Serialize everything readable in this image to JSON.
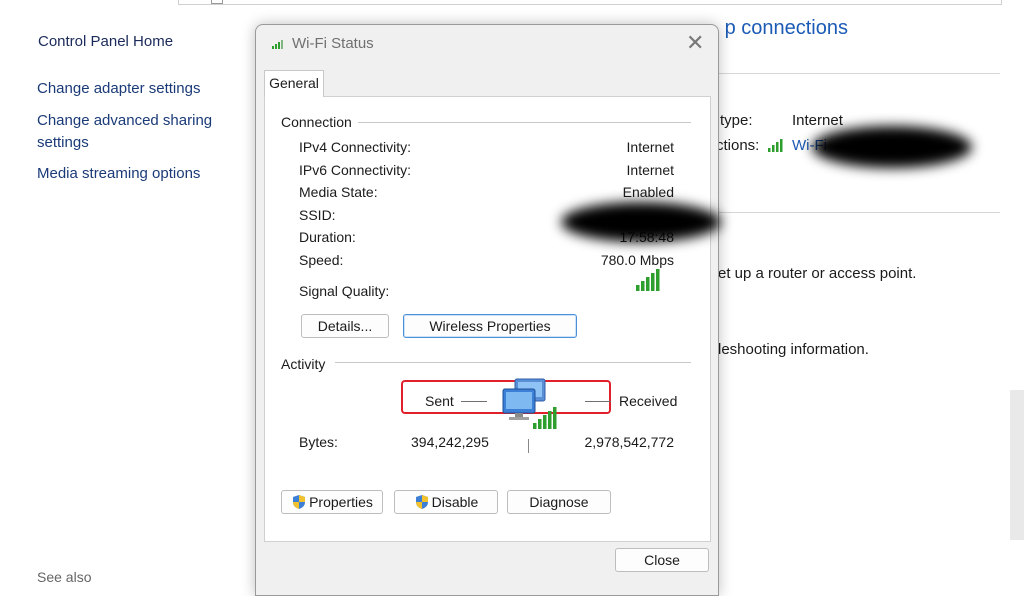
{
  "background": {
    "sidebar": {
      "home": "Control Panel Home",
      "adapter": "Change adapter settings",
      "sharing": "Change advanced sharing settings",
      "media": "Media streaming options",
      "see_also": "See also"
    },
    "heading_partial": "p connections",
    "access_type_label": "type:",
    "access_type_value": "Internet",
    "connections_label": "ctions:",
    "connections_value": "Wi-Fi",
    "setup_text": "et up a router or access point.",
    "troubleshoot_text": "leshooting information."
  },
  "dialog": {
    "title": "Wi-Fi Status",
    "tab_general": "General",
    "connection_group": "Connection",
    "rows": [
      {
        "label": "IPv4 Connectivity:",
        "value": "Internet"
      },
      {
        "label": "IPv6 Connectivity:",
        "value": "Internet"
      },
      {
        "label": "Media State:",
        "value": "Enabled"
      },
      {
        "label": "SSID:",
        "value": ""
      },
      {
        "label": "Duration:",
        "value": "17:58:48"
      },
      {
        "label": "Speed:",
        "value": "780.0 Mbps"
      }
    ],
    "signal_label": "Signal Quality:",
    "signal_bars": 5,
    "details_button": "Details...",
    "wireless_button": "Wireless Properties",
    "activity_group": "Activity",
    "sent_label": "Sent",
    "received_label": "Received",
    "bytes_label": "Bytes:",
    "bytes_sent": "394,242,295",
    "bytes_received": "2,978,542,772",
    "properties_button": "Properties",
    "disable_button": "Disable",
    "diagnose_button": "Diagnose",
    "close_button": "Close",
    "accent_color": "#e0202a",
    "signal_color": "#2e9e2e"
  }
}
